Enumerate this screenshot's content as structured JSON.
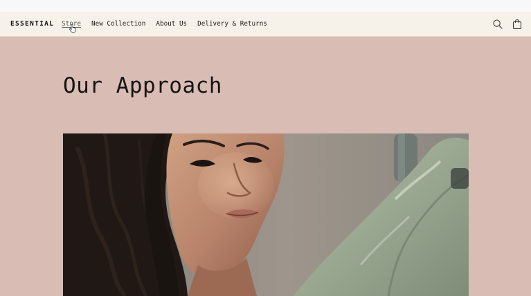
{
  "header": {
    "logo": "ESSENTIAL",
    "nav": [
      {
        "label": "Store",
        "active": true
      },
      {
        "label": "New Collection",
        "active": false
      },
      {
        "label": "About Us",
        "active": false
      },
      {
        "label": "Delivery & Returns",
        "active": false
      }
    ],
    "icons": [
      "search-icon",
      "shopping-bag-icon"
    ]
  },
  "main": {
    "title": "Our Approach",
    "hero_image": "woman-with-dark-wavy-hair-beside-sage-green-jacket"
  },
  "colors": {
    "page_background": "#d9bcb3",
    "header_background": "#f7f2e9",
    "text": "#1a1a1a"
  }
}
